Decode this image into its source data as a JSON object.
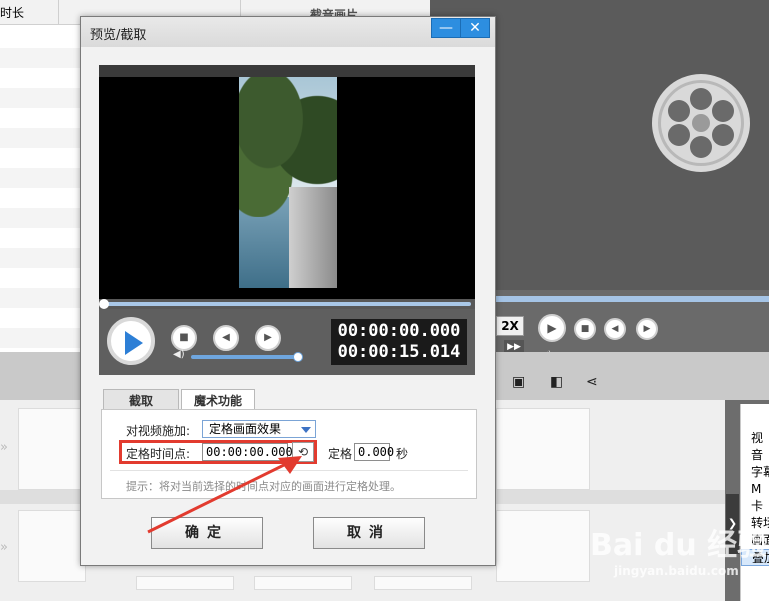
{
  "background": {
    "left_header_col1": "时长",
    "left_header_col2": "截音画片",
    "speed_label": "2X",
    "side_list": [
      "视",
      "音",
      "字幕",
      "M",
      "卡",
      "转场",
      "画面",
      "叠加"
    ]
  },
  "dialog": {
    "title": "预览/截取",
    "minimize_glyph": "—",
    "close_glyph": "✕",
    "time_current": "00:00:00.000",
    "time_total": "00:00:15.014",
    "tabs": [
      {
        "label": "截取"
      },
      {
        "label": "魔术功能"
      }
    ],
    "apply_label": "对视频施加:",
    "effect_value": "定格画面效果",
    "freeze_point_label": "定格时间点:",
    "freeze_point_value": "00:00:00.000",
    "freeze_label": "定格",
    "freeze_duration": "0.000",
    "seconds_unit": "秒",
    "hint": "提示：将对当前选择的时间点对应的画面进行定格处理。",
    "ok_label": "确定",
    "cancel_label": "取消"
  },
  "watermark": {
    "brand": "Bai du 经验",
    "url": "jingyan.baidu.com"
  },
  "colors": {
    "accent": "#2d8ee0",
    "highlight": "#e23b2f"
  }
}
